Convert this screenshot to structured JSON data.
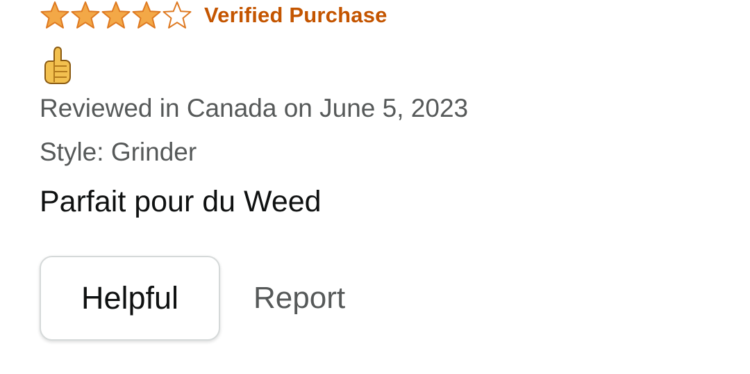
{
  "review": {
    "rating": 4,
    "max_rating": 5,
    "verified_label": "Verified Purchase",
    "reaction_icon": "thumbs-up-icon",
    "date_text": "Reviewed in Canada on June 5, 2023",
    "style_text": "Style: Grinder",
    "title": "Parfait pour du Weed"
  },
  "actions": {
    "helpful_label": "Helpful",
    "report_label": "Report"
  },
  "colors": {
    "star_fill": "#f3a847",
    "star_stroke": "#de7921",
    "verified": "#c45500",
    "meta_text": "#565959",
    "title_text": "#0f1111",
    "button_border": "#d5d9d9"
  }
}
